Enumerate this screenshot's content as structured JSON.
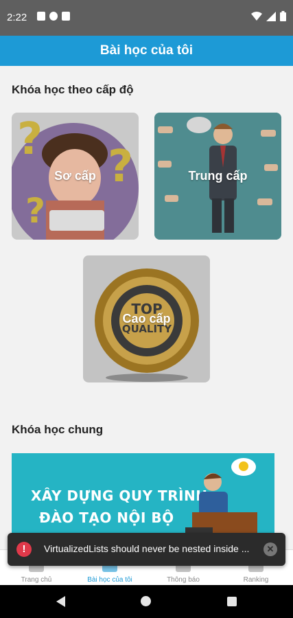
{
  "status_bar": {
    "time": "2:22",
    "icons": [
      "a-notification-icon",
      "p-notification-icon",
      "sim-card-icon",
      "wifi-icon",
      "signal-icon",
      "battery-icon"
    ]
  },
  "app_bar": {
    "title": "Bài học của tôi"
  },
  "levels_section": {
    "title": "Khóa học theo cấp độ",
    "cards": [
      {
        "label": "Sơ cấp"
      },
      {
        "label": "Trung cấp"
      },
      {
        "label": "Cao cấp"
      }
    ]
  },
  "general_section": {
    "title": "Khóa học chung",
    "banner_text": [
      "XÂY DỰNG QUY TRÌNH",
      "ĐÀO TẠO NỘI BỘ"
    ]
  },
  "bottom_nav": {
    "items": [
      {
        "label": "Trang chủ",
        "icon": "home-icon"
      },
      {
        "label": "Bài học của tôi",
        "icon": "book-icon",
        "active": true
      },
      {
        "label": "Thông báo",
        "icon": "bell-icon"
      },
      {
        "label": "Ranking",
        "icon": "ranking-icon"
      }
    ]
  },
  "toast": {
    "message": "VirtualizedLists should never be nested inside ..."
  },
  "colors": {
    "app_bar": "#1d9ad6",
    "toast_bg": "#2b2b2b",
    "error": "#e0394a",
    "banner": "#25b4c4"
  }
}
